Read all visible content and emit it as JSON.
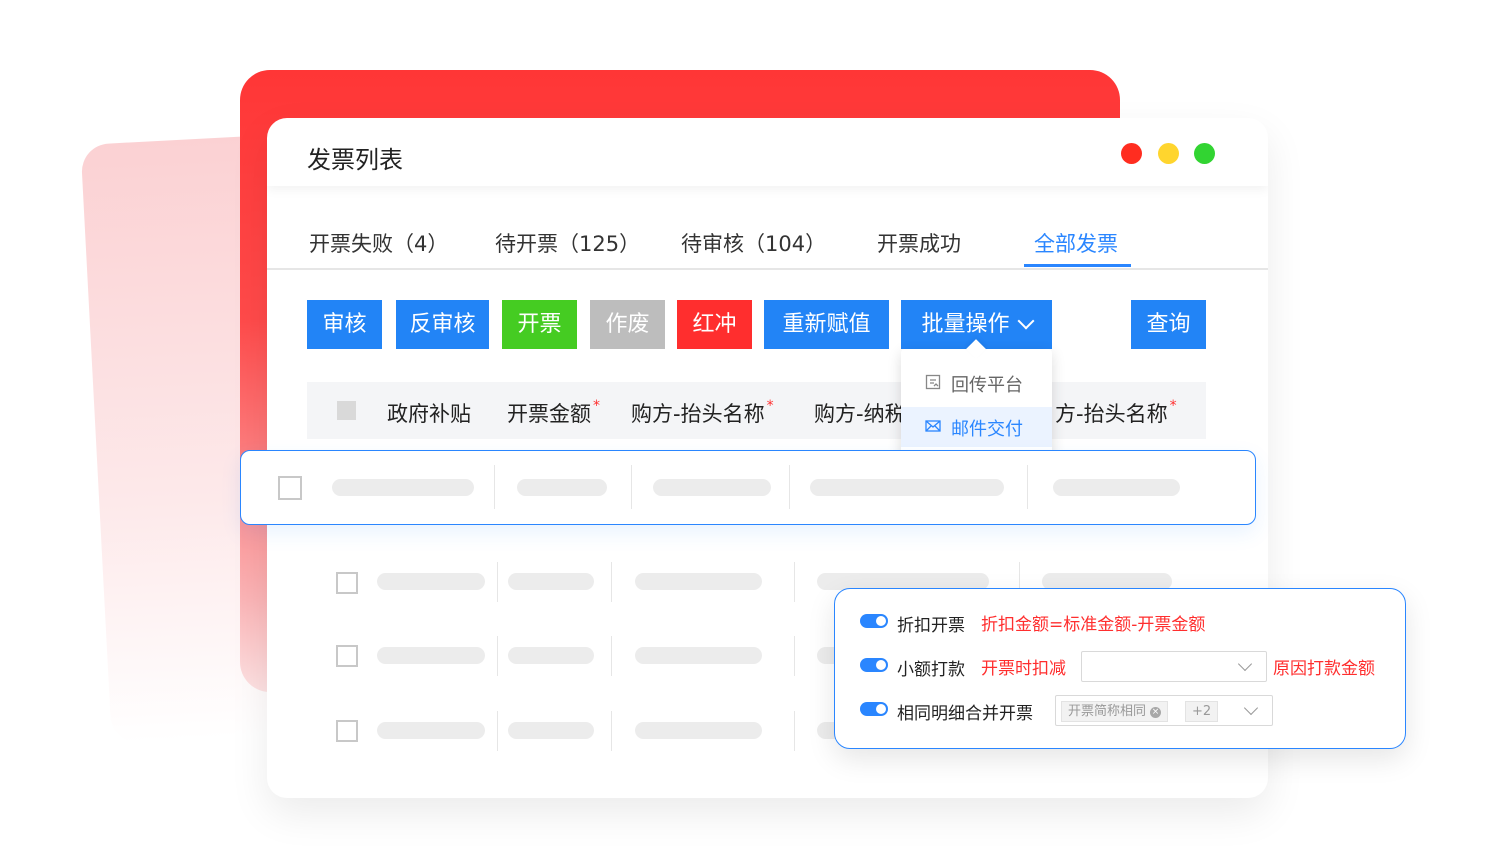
{
  "window": {
    "title": "发票列表"
  },
  "tabs": [
    {
      "label": "开票失败（4）"
    },
    {
      "label": "待开票（125）"
    },
    {
      "label": "待审核（104）"
    },
    {
      "label": "开票成功"
    },
    {
      "label": "全部发票",
      "active": true
    }
  ],
  "toolbar": {
    "audit": "审核",
    "unaudit": "反审核",
    "issue": "开票",
    "void": "作废",
    "red_flush": "红冲",
    "reassign": "重新赋值",
    "batch": "批量操作",
    "query": "查询"
  },
  "batch_menu": {
    "items": [
      {
        "label": "回传平台",
        "icon": "upload-platform-icon"
      },
      {
        "label": "邮件交付",
        "icon": "mail-icon",
        "highlighted": true
      }
    ]
  },
  "table": {
    "headers": [
      {
        "label": "政府补贴",
        "required": false
      },
      {
        "label": "开票金额",
        "required": true
      },
      {
        "label": "购方-抬头名称",
        "required": true
      },
      {
        "label": "购方-纳税",
        "required": false
      },
      {
        "label": "方-抬头名称",
        "required": true
      }
    ],
    "required_mark": "*"
  },
  "settings_panel": {
    "discount": {
      "label": "折扣开票",
      "enabled": true,
      "formula": "折扣金额=标准金额-开票金额"
    },
    "small_payment": {
      "label": "小额打款",
      "enabled": true,
      "hint": "开票时扣减",
      "select_value": "",
      "note": "原因打款金额"
    },
    "merge": {
      "label": "相同明细合并开票",
      "enabled": true,
      "tag": "开票简称相同",
      "more": "+2"
    }
  },
  "colors": {
    "accent": "#2a86ff",
    "primary_button": "#2284f6",
    "success_button": "#45cc22",
    "disabled_button": "#bdbdbd",
    "danger": "#ff2e2e",
    "traffic_red": "#ff2d20",
    "traffic_yellow": "#ffd52e",
    "traffic_green": "#32d432"
  }
}
